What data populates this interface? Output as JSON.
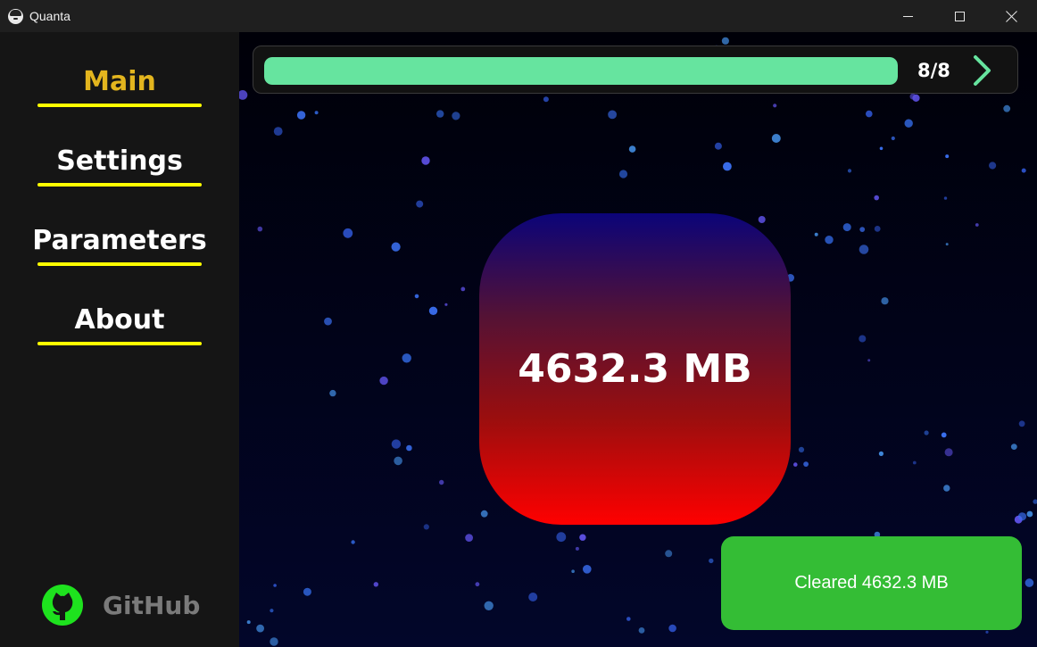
{
  "window": {
    "title": "Quanta",
    "controls": {
      "minimize": "minimize-icon",
      "maximize": "maximize-icon",
      "close": "close-icon"
    }
  },
  "sidebar": {
    "items": [
      {
        "label": "Main",
        "active": true
      },
      {
        "label": "Settings",
        "active": false
      },
      {
        "label": "Parameters",
        "active": false
      },
      {
        "label": "About",
        "active": false
      }
    ],
    "github": {
      "label": "GitHub",
      "icon": "github-icon",
      "icon_color": "#1ee21e"
    }
  },
  "progress": {
    "current": 8,
    "total": 8,
    "text": "8/8",
    "fraction": 1.0,
    "fill_color": "#66e49f",
    "next_icon": "chevron-right-icon"
  },
  "size_display": {
    "text": "4632.3 MB"
  },
  "toast": {
    "text": "Cleared 4632.3 MB",
    "color": "#34bd35"
  },
  "colors": {
    "accent_underline": "#ffff00",
    "active_nav": "#e3b51e",
    "sidebar_bg": "#151515"
  }
}
